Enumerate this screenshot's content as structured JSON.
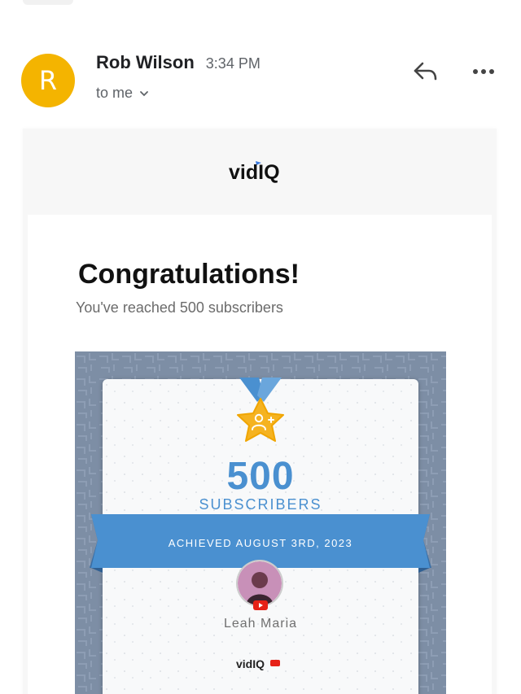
{
  "header": {
    "avatar_letter": "R",
    "sender_name": "Rob Wilson",
    "sent_time": "3:34 PM",
    "recipient": "to me"
  },
  "icons": {
    "reply": "reply-icon",
    "more": "more-icon",
    "chevron": "chevron-down-icon"
  },
  "email": {
    "brand": "vidIQ",
    "headline": "Congratulations!",
    "subline": "You've reached 500 subscribers",
    "milestone": {
      "count": "500",
      "unit": "SUBSCRIBERS",
      "achieved": "ACHIEVED AUGUST 3RD, 2023",
      "channel_name": "Leah Maria",
      "footer_brand": "vidIQ"
    }
  },
  "colors": {
    "avatar": "#f4b400",
    "accent_blue": "#4a90d0",
    "badge_gold": "#f5b321",
    "card_background": "#7d8ea5"
  }
}
